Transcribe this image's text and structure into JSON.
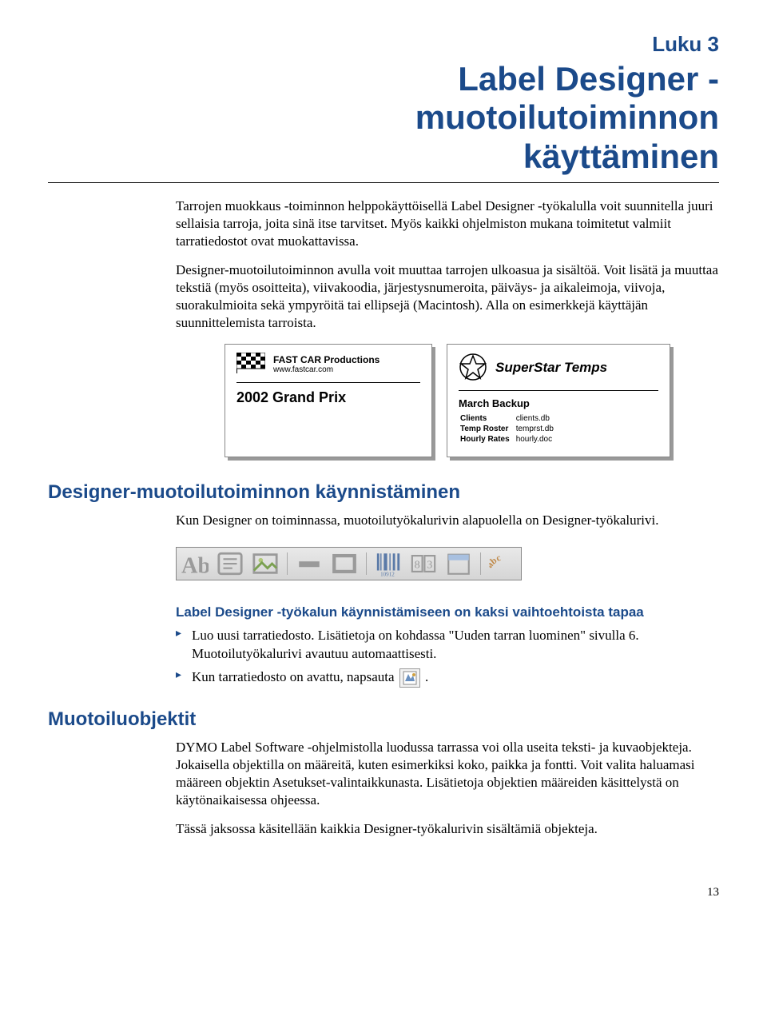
{
  "chapter_label": "Luku 3",
  "chapter_title_line1": "Label Designer -",
  "chapter_title_line2": "muotoilutoiminnon",
  "chapter_title_line3": "käyttäminen",
  "intro_p1": "Tarrojen muokkaus -toiminnon helppokäyttöisellä Label Designer -työkalulla voit suunnitella juuri sellaisia tarroja, joita sinä itse tarvitset. Myös kaikki ohjelmiston mukana toimitetut valmiit tarratiedostot ovat muokattavissa.",
  "intro_p2": "Designer-muotoilutoiminnon avulla voit muuttaa tarrojen ulkoasua ja sisältöä. Voit lisätä ja muuttaa tekstiä (myös osoitteita), viivakoodia, järjestysnumeroita, päiväys- ja aikaleimoja, viivoja, suorakulmioita sekä ympyröitä tai ellipsejä (Macintosh). Alla on esimerkkejä käyttäjän suunnittelemista tarroista.",
  "label1": {
    "company": "FAST CAR Productions",
    "url": "www.fastcar.com",
    "main": "2002 Grand Prix"
  },
  "label2": {
    "company": "SuperStar Temps",
    "sub": "March Backup",
    "rows": [
      [
        "Clients",
        "clients.db"
      ],
      [
        "Temp Roster",
        "temprst.db"
      ],
      [
        "Hourly Rates",
        "hourly.doc"
      ]
    ]
  },
  "section1_title": "Designer-muotoilutoiminnon käynnistäminen",
  "section1_p": "Kun Designer on toiminnassa, muotoilutyökalurivin alapuolella on Designer-työkalurivi.",
  "section1_sub": "Label Designer -työkalun käynnistämiseen on kaksi vaihtoehtoista tapaa",
  "section1_li1": "Luo uusi tarratiedosto. Lisätietoja on kohdassa \"Uuden tarran luominen\" sivulla 6. Muotoilutyökalurivi avautuu automaattisesti.",
  "section1_li2_a": "Kun tarratiedosto on avattu, napsauta ",
  "section1_li2_b": ".",
  "section2_title": "Muotoiluobjektit",
  "section2_p1": "DYMO Label Software -ohjelmistolla luodussa tarrassa voi olla useita teksti- ja kuvaobjekteja. Jokaisella objektilla on määreitä, kuten esimerkiksi koko, paikka ja fontti. Voit valita haluamasi määreen objektin Asetukset-valintaikkunasta. Lisätietoja objektien määreiden käsittelystä on käytönaikaisessa ohjeessa.",
  "section2_p2": "Tässä jaksossa käsitellään kaikkia Designer-työkalurivin sisältämiä objekteja.",
  "page_number": "13"
}
